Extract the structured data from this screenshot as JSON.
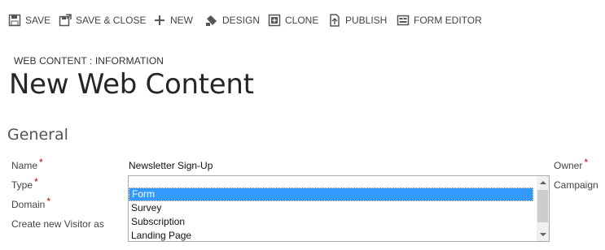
{
  "toolbar": {
    "save": "SAVE",
    "save_close": "SAVE & CLOSE",
    "new": "NEW",
    "design": "DESIGN",
    "clone": "CLONE",
    "publish": "PUBLISH",
    "form_editor": "FORM EDITOR"
  },
  "header": {
    "entity": "WEB CONTENT : INFORMATION",
    "title": "New Web Content"
  },
  "section": {
    "title": "General"
  },
  "fields": {
    "name_label": "Name",
    "name_value": "Newsletter Sign-Up",
    "type_label": "Type",
    "domain_label": "Domain",
    "visitor_label": "Create new Visitor as",
    "owner_label": "Owner",
    "campaign_label": "Campaign",
    "required_mark": "*"
  },
  "type_options": [
    "Form",
    "Survey",
    "Subscription",
    "Landing Page"
  ],
  "selected_option": "Form",
  "colors": {
    "selection": "#3399ff",
    "required": "#c00000"
  }
}
